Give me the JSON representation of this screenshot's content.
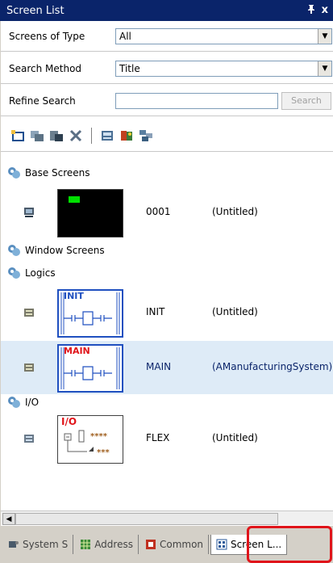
{
  "window": {
    "title": "Screen List",
    "pin_glyph": "ᵖ",
    "close_glyph": "x"
  },
  "filters": {
    "screens_of_type": {
      "label": "Screens of Type",
      "value": "All"
    },
    "search_method": {
      "label": "Search Method",
      "value": "Title"
    },
    "refine_search": {
      "label": "Refine Search",
      "value": "",
      "button": "Search"
    }
  },
  "toolbar": {
    "icons": [
      "new-screen-icon",
      "copy-screen-icon",
      "paste-screen-icon",
      "delete-icon",
      "properties-icon",
      "library-icon",
      "tile-icon"
    ]
  },
  "tree": {
    "groups": {
      "base": "Base Screens",
      "window": "Window Screens",
      "logics": "Logics",
      "io": "I/O"
    },
    "items": [
      {
        "id": "0001",
        "name": "(Untitled)"
      },
      {
        "id": "INIT",
        "name": "(Untitled)",
        "thumb_label": "INIT"
      },
      {
        "id": "MAIN",
        "name": "(AManufacturingSystem)",
        "thumb_label": "MAIN",
        "selected": true
      },
      {
        "id": "FLEX",
        "name": "(Untitled)",
        "thumb_label": "I/O",
        "thumb_marks1": "****",
        "thumb_marks2": "***"
      }
    ]
  },
  "tabs": [
    {
      "label": "System S"
    },
    {
      "label": "Address"
    },
    {
      "label": "Common"
    },
    {
      "label": "Screen L...",
      "active": true
    }
  ],
  "colors": {
    "title_bg": "#0a246a",
    "highlight": "#e0141a",
    "selection": "#deebf7"
  }
}
